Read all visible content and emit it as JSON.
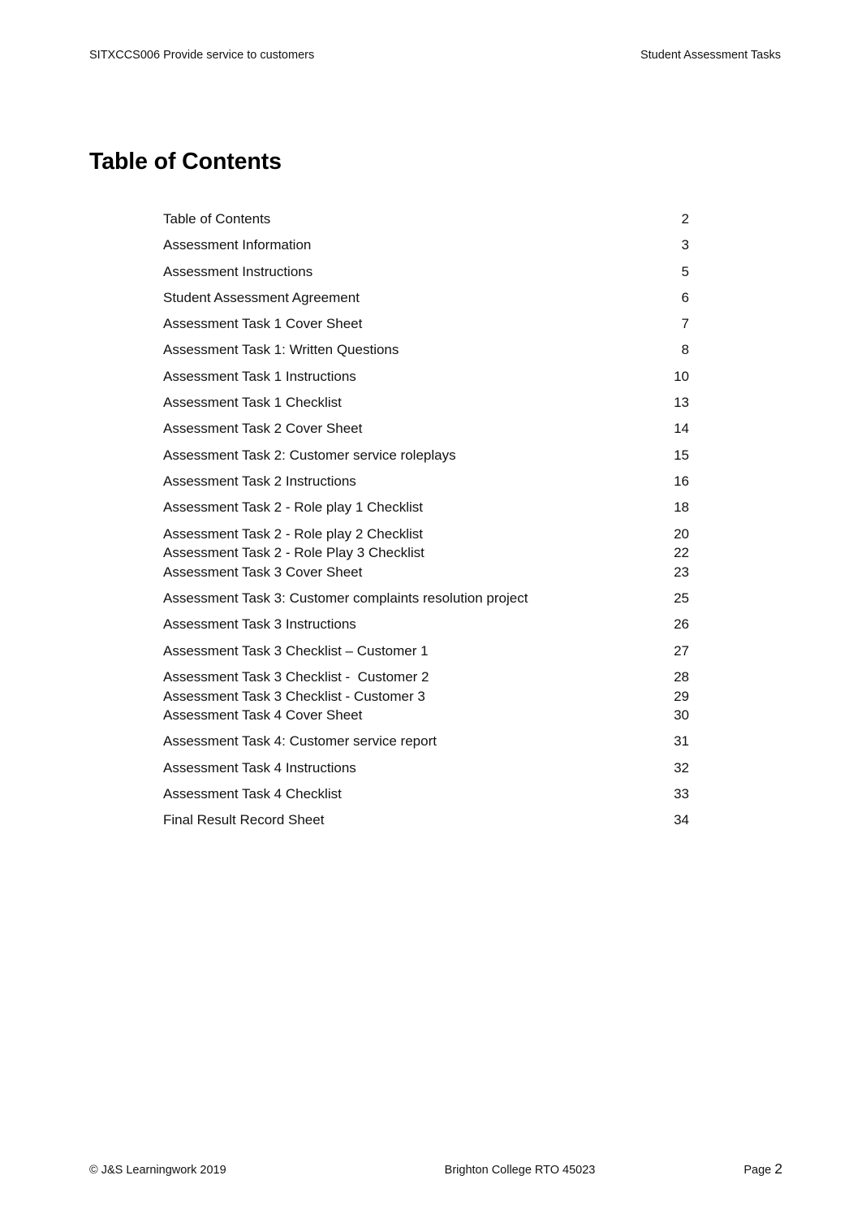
{
  "header": {
    "left": "SITXCCS006 Provide service to customers",
    "right": "Student Assessment Tasks"
  },
  "title": "Table of Contents",
  "toc": {
    "entries": [
      {
        "label": "Table of Contents",
        "page": "2",
        "tight": false
      },
      {
        "label": "Assessment Information",
        "page": "3",
        "tight": false
      },
      {
        "label": "Assessment Instructions",
        "page": "5",
        "tight": false
      },
      {
        "label": "Student Assessment Agreement",
        "page": "6",
        "tight": false
      },
      {
        "label": "Assessment Task 1 Cover Sheet",
        "page": "7",
        "tight": false
      },
      {
        "label": "Assessment Task 1: Written Questions",
        "page": "8",
        "tight": false
      },
      {
        "label": "Assessment Task 1 Instructions",
        "page": "10",
        "tight": false
      },
      {
        "label": "Assessment Task 1 Checklist",
        "page": "13",
        "tight": false
      },
      {
        "label": "Assessment Task 2 Cover Sheet",
        "page": "14",
        "tight": false
      },
      {
        "label": "Assessment Task 2: Customer service roleplays",
        "page": "15",
        "tight": false
      },
      {
        "label": "Assessment Task 2 Instructions",
        "page": "16",
        "tight": false
      },
      {
        "label": "Assessment Task 2 - Role play 1 Checklist",
        "page": "18",
        "tight": false
      },
      {
        "label": "Assessment Task 2 - Role play 2 Checklist",
        "page": "20",
        "tight": true
      },
      {
        "label": "Assessment Task 2 - Role Play 3 Checklist",
        "page": "22",
        "tight": true
      },
      {
        "label": "Assessment Task 3 Cover Sheet",
        "page": "23",
        "tight": false
      },
      {
        "label": "Assessment Task 3: Customer complaints resolution project",
        "page": "25",
        "tight": false
      },
      {
        "label": "Assessment Task 3 Instructions",
        "page": "26",
        "tight": false
      },
      {
        "label": "Assessment Task 3 Checklist – Customer 1",
        "page": "27",
        "tight": false
      },
      {
        "label": "Assessment Task 3 Checklist -  Customer 2",
        "page": "28",
        "tight": true
      },
      {
        "label": "Assessment Task 3 Checklist - Customer 3",
        "page": "29",
        "tight": true
      },
      {
        "label": "Assessment Task 4 Cover Sheet",
        "page": "30",
        "tight": false
      },
      {
        "label": "Assessment Task 4: Customer service report",
        "page": "31",
        "tight": false
      },
      {
        "label": "Assessment Task 4 Instructions",
        "page": "32",
        "tight": false
      },
      {
        "label": "Assessment Task 4 Checklist",
        "page": "33",
        "tight": false
      },
      {
        "label": "Final Result Record Sheet",
        "page": "34",
        "tight": false
      }
    ]
  },
  "footer": {
    "left": "© J&S Learningwork 2019",
    "center": "Brighton College RTO 45023",
    "page_label": "Page ",
    "page_number": "2"
  }
}
